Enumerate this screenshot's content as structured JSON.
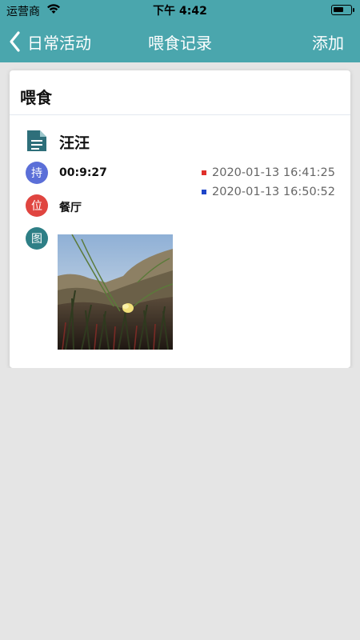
{
  "status_bar": {
    "carrier": "运营商",
    "time": "下午 4:42"
  },
  "nav": {
    "back_label": "日常活动",
    "title": "喂食记录",
    "add_label": "添加"
  },
  "record": {
    "section_title": "喂食",
    "pet_name": "汪汪",
    "duration_badge": "持",
    "duration": "00:9:27",
    "location_badge": "位",
    "location": "餐厅",
    "photo_badge": "图",
    "start_time": "2020-01-13 16:41:25",
    "end_time": "2020-01-13 16:50:52"
  },
  "colors": {
    "header_teal": "#4aa6ad",
    "badge_duration": "#5b6fd8",
    "badge_location": "#e04540",
    "badge_photo": "#2e7f86",
    "start_marker": "#e0302b",
    "end_marker": "#1f45c8"
  }
}
